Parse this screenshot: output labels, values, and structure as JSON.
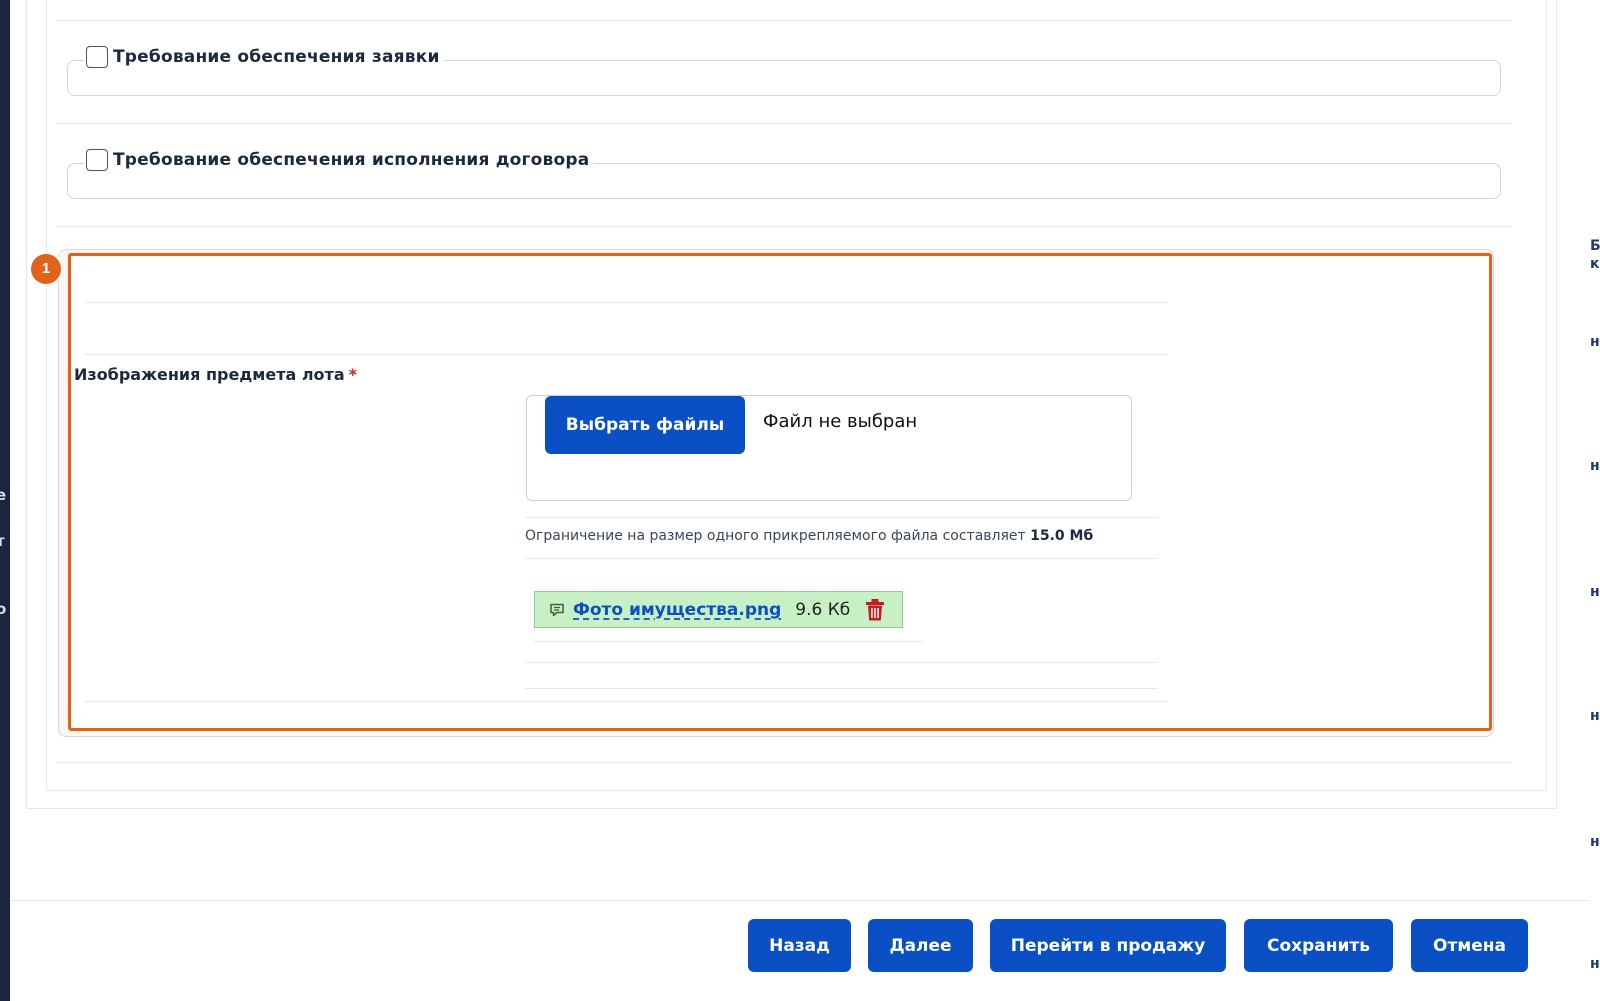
{
  "sections": {
    "bid_security": {
      "label": "Требование обеспечения заявки",
      "checked": false
    },
    "contract_security": {
      "label": "Требование обеспечения исполнения договора",
      "checked": false
    }
  },
  "callout": {
    "number": "1",
    "color": "#e2621b"
  },
  "lot_images": {
    "label": "Изображения предмета лота",
    "required_mark": "*",
    "choose_button": "Выбрать файлы",
    "no_file_text": "Файл не выбран",
    "limit_text": "Ограничение на размер одного прикрепляемого файла составляет",
    "limit_value": "15.0 Мб",
    "files": [
      {
        "name": "Фото имущества.png",
        "size": "9.6 Кб"
      }
    ]
  },
  "footer": {
    "back": "Назад",
    "next": "Далее",
    "go_to_sale": "Перейти в продажу",
    "save": "Сохранить",
    "cancel": "Отмена"
  },
  "colors": {
    "primary": "#0a4fc4",
    "highlight": "#e2621b",
    "file_chip_bg": "#c8f0c5",
    "required": "#cf1f1f"
  },
  "icons": [
    "comment-icon",
    "trash-icon"
  ]
}
